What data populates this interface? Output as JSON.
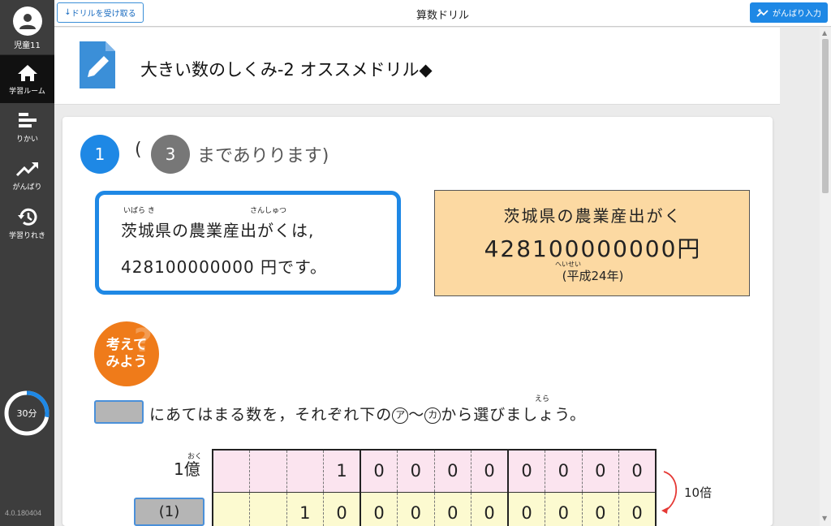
{
  "sidebar": {
    "user_name": "児童11",
    "items": [
      {
        "label": "学習ルーム",
        "icon": "home-icon",
        "active": true
      },
      {
        "label": "りかい",
        "icon": "bars-icon",
        "active": false
      },
      {
        "label": "がんばり",
        "icon": "trend-up-icon",
        "active": false
      },
      {
        "label": "学習りれき",
        "icon": "history-icon",
        "active": false
      }
    ],
    "timer_label": "30分",
    "timer_progress": 0.28,
    "version": "4.0.180404"
  },
  "topbar": {
    "receive_label": "ドリルを受け取る",
    "app_title": "算数ドリル",
    "input_label": "がんばり入力"
  },
  "drill": {
    "title": "大きい数のしくみ-2 オススメドリル◆"
  },
  "question": {
    "current": "1",
    "paren_open": "(",
    "total": "3",
    "total_suffix": "までありります)",
    "speech_ruby1": "いばら き",
    "speech_ruby2": "さんしゅつ",
    "speech_line1": "茨城県の農業産出がくは,",
    "speech_line2": "428100000000 円です。",
    "info_title": "茨城県の農業産出がく",
    "info_value": "428100000000円",
    "info_ruby": "へいせい",
    "info_note": "(平成24年)",
    "think_label": "考えて\nみよう",
    "instruction": "にあてはまる数を，それぞれ下の",
    "instruction_a": "ア",
    "instruction_tilde": "〜",
    "instruction_ka": "カ",
    "instruction_end": "から選びましょう。",
    "instruction_ruby": "えら",
    "row1_ruby": "おく",
    "row1_label": "1億",
    "row2_blank": "(1)",
    "ten_times": "10倍",
    "row1_digits": [
      "",
      "",
      "",
      "1",
      "0",
      "0",
      "0",
      "0",
      "0",
      "0",
      "0",
      "0"
    ],
    "row2_digits": [
      "",
      "",
      "1",
      "0",
      "0",
      "0",
      "0",
      "0",
      "0",
      "0",
      "0",
      "0"
    ]
  },
  "colors": {
    "accent": "#1e88e5",
    "sidebar": "#3d3d3d",
    "info_bg": "#fcd9a2",
    "think_badge": "#ef7b1a"
  }
}
